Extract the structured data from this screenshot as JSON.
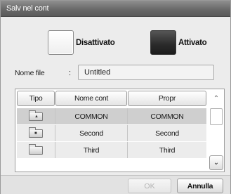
{
  "window": {
    "title": "Salv nel cont"
  },
  "mode": {
    "off_label": "Disattivato",
    "on_label": "Attivato"
  },
  "file": {
    "label": "Nome file",
    "separator": ":",
    "value": "Untitled"
  },
  "table": {
    "columns": [
      "Tipo",
      "Nome cont",
      "Propr"
    ],
    "rows": [
      {
        "icon": "shared-folder-icon",
        "name": "COMMON",
        "owner": "COMMON"
      },
      {
        "icon": "locked-folder-icon",
        "name": "Second",
        "owner": "Second"
      },
      {
        "icon": "folder-icon",
        "name": "Third",
        "owner": "Third"
      }
    ]
  },
  "scrollbar": {
    "up_icon": "chevron-up-icon",
    "down_icon": "chevron-down-icon"
  },
  "footer": {
    "ok_label": "OK",
    "cancel_label": "Annulla"
  }
}
